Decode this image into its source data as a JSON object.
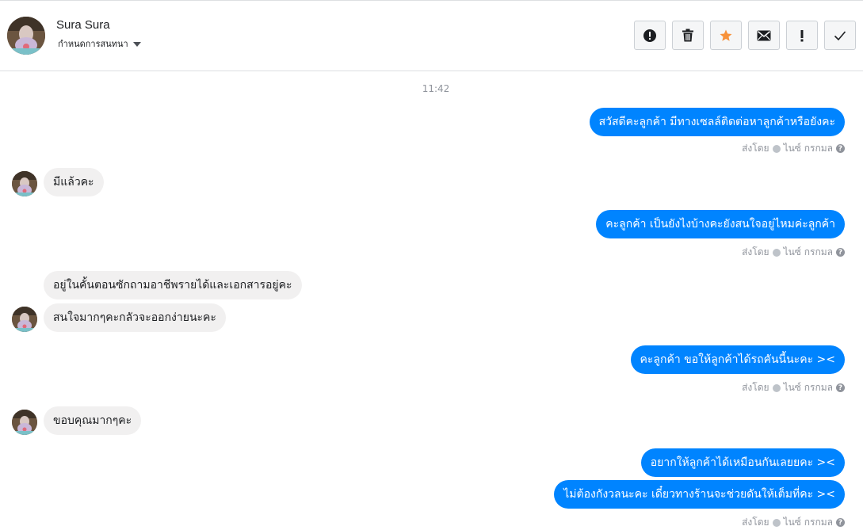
{
  "contact": {
    "name": "Sura Sura",
    "subtitle": "กำหนดการสนทนา"
  },
  "toolbar": {
    "buttons": [
      {
        "name": "report-icon",
        "glyph": "!"
      },
      {
        "name": "trash-icon",
        "glyph": ""
      },
      {
        "name": "star-icon",
        "glyph": "★"
      },
      {
        "name": "envelope-icon",
        "glyph": ""
      },
      {
        "name": "exclamation-icon",
        "glyph": "!"
      },
      {
        "name": "checkmark-icon",
        "glyph": "✓"
      }
    ]
  },
  "conversation": {
    "timestamp": "11:42",
    "sent_by_label": "ส่งโดย",
    "sent_by_name": "ไนซ์ กรกมล",
    "messages": [
      {
        "dir": "out",
        "text": "สวัสดีคะลูกค้า มีทางเซลล์ติดต่อหาลูกค้าหรือยังคะ"
      },
      {
        "dir": "in",
        "text": "มีแล้วคะ"
      },
      {
        "dir": "out",
        "text": "คะลูกค้า เป็นยังไงบ้างคะยังสนใจอยู่ไหมค่ะลูกค้า"
      },
      {
        "dir": "in",
        "text": "อยู่ในคั้นตอนซักถามอาชีพรายได้และเอกสารอยู่คะ"
      },
      {
        "dir": "in",
        "text": "สนใจมากๆคะกลัวจะออกง่ายนะคะ"
      },
      {
        "dir": "out",
        "text": "คะลูกค้า ขอให้ลูกค้าได้รถคันนี้นะคะ ><"
      },
      {
        "dir": "in",
        "text": "ขอบคุณมากๆคะ"
      },
      {
        "dir": "out",
        "text": "อยากให้ลูกค้าได้เหมือนกันเลยยคะ ><"
      },
      {
        "dir": "out",
        "text": "ไม่ต้องกังวลนะคะ เดี๋ยวทางร้านจะช่วยดันให้เต็มที่คะ ><"
      }
    ]
  },
  "colors": {
    "outgoing_bubble": "#0084ff",
    "incoming_bubble": "#f1f0f0",
    "star": "#f7923b"
  }
}
